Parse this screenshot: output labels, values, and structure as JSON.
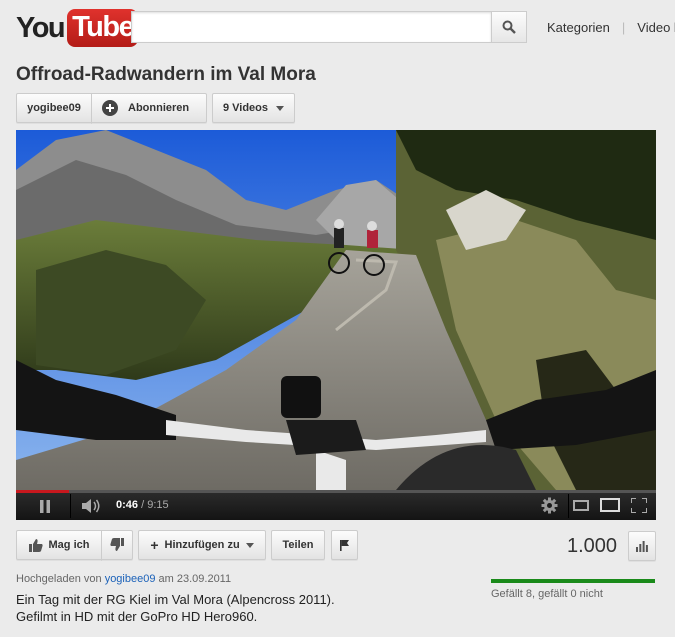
{
  "header": {
    "logo_you": "You",
    "logo_tube": "Tube",
    "search_placeholder": "",
    "nav": [
      "Kategorien",
      "Video h"
    ]
  },
  "video": {
    "title": "Offroad-Radwandern im Val Mora",
    "channel": "yogibee09",
    "subscribe_label": "Abonnieren",
    "videos_label": "9 Videos",
    "time_current": "0:46",
    "time_separator": " / ",
    "time_total": "9:15",
    "progress": 0.083
  },
  "actions": {
    "like_label": "Mag ich",
    "add_label": "Hinzufügen zu",
    "share_label": "Teilen"
  },
  "stats": {
    "views": "1.000",
    "likes_text": "Gefällt 8, gefällt 0 nicht",
    "like_ratio": 1.0
  },
  "info": {
    "uploaded_prefix": "Hochgeladen von",
    "uploader": "yogibee09",
    "uploaded_date": "am 23.09.2011",
    "description_line1": "Ein Tag mit der RG Kiel im Val Mora (Alpencross 2011).",
    "description_line2": "Gefilmt in HD mit der GoPro HD Hero960."
  },
  "colors": {
    "brand_red": "#cc181e",
    "link_blue": "#1c62b9",
    "like_bar_green": "#1a8a1a"
  }
}
